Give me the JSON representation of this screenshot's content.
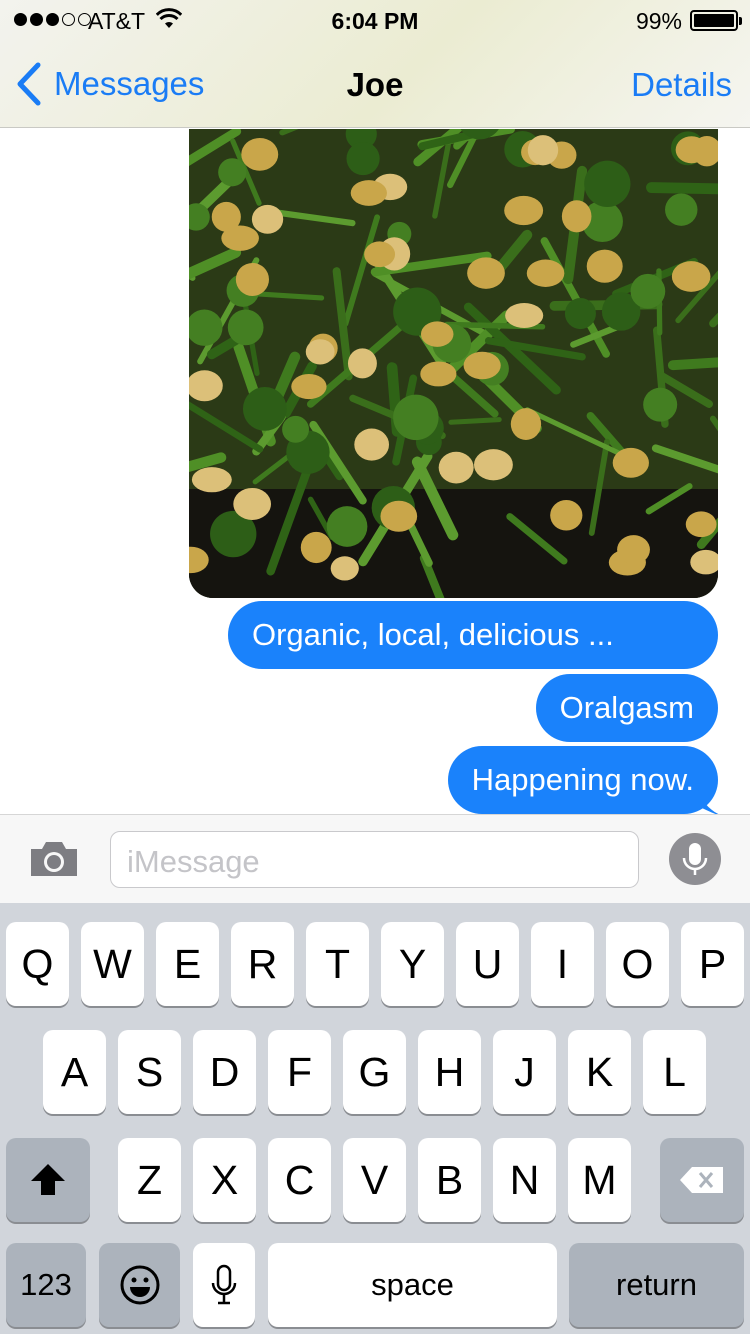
{
  "status_bar": {
    "carrier": "AT&T",
    "signal_bars_filled": 3,
    "signal_bars_total": 5,
    "time": "6:04 PM",
    "battery_percent": "99%",
    "battery_level": 0.99
  },
  "nav": {
    "back_label": "Messages",
    "title": "Joe",
    "details_label": "Details"
  },
  "messages": [
    {
      "text": "Organic, local, delicious  ...",
      "direction": "outgoing"
    },
    {
      "text": "Oralgasm",
      "direction": "outgoing"
    },
    {
      "text": "Happening now.",
      "direction": "outgoing"
    }
  ],
  "photo": {
    "subject": "broccolini and chickpeas in a pan"
  },
  "input": {
    "placeholder": "iMessage"
  },
  "keyboard": {
    "row1": [
      "Q",
      "W",
      "E",
      "R",
      "T",
      "Y",
      "U",
      "I",
      "O",
      "P"
    ],
    "row2": [
      "A",
      "S",
      "D",
      "F",
      "G",
      "H",
      "J",
      "K",
      "L"
    ],
    "row3": [
      "Z",
      "X",
      "C",
      "V",
      "B",
      "N",
      "M"
    ],
    "numbers_label": "123",
    "space_label": "space",
    "return_label": "return"
  },
  "colors": {
    "accent": "#1a7cf5",
    "bubble": "#1a82fb",
    "keyboard_bg": "#d1d5db",
    "dark_key": "#acb3bc"
  },
  "icons": [
    "wifi-icon",
    "battery-icon",
    "chevron-left-icon",
    "camera-icon",
    "microphone-icon",
    "shift-icon",
    "delete-icon",
    "emoji-icon",
    "dictation-icon"
  ]
}
